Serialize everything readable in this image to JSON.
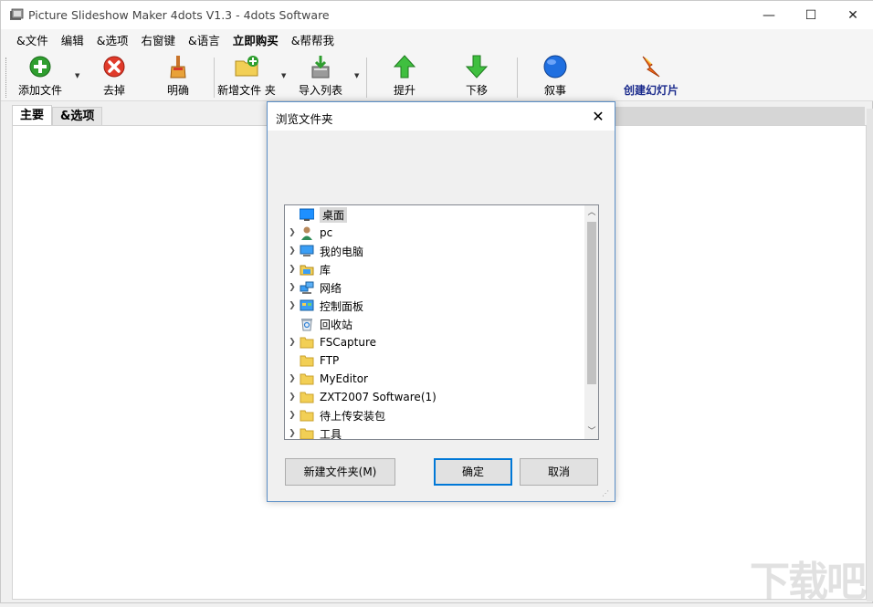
{
  "window": {
    "title": "Picture Slideshow Maker 4dots V1.3 - 4dots Software",
    "min_glyph": "—",
    "max_glyph": "☐",
    "close_glyph": "✕"
  },
  "menu": {
    "items": [
      {
        "label": "&文件"
      },
      {
        "label": "编辑"
      },
      {
        "label": "&选项"
      },
      {
        "label": "右窗键"
      },
      {
        "label": "&语言"
      },
      {
        "label": "立即购买"
      },
      {
        "label": "&帮帮我"
      }
    ]
  },
  "toolbar": {
    "add_files": "添加文件",
    "remove": "去掉",
    "clear": "明确",
    "add_folder": "新增文件 夹",
    "import_list": "导入列表",
    "move_up": "提升",
    "move_down": "下移",
    "narrate": "叙事",
    "create_slideshow": "创建幻灯片"
  },
  "tabs": [
    {
      "label": "主要"
    },
    {
      "label": "&选项"
    }
  ],
  "dialog": {
    "title": "浏览文件夹",
    "close_glyph": "✕",
    "tree": [
      {
        "label": "桌面",
        "icon": "desktop-icon",
        "expandable": false,
        "selected": true
      },
      {
        "label": "pc",
        "icon": "user-icon",
        "expandable": true
      },
      {
        "label": "我的电脑",
        "icon": "computer-icon",
        "expandable": true
      },
      {
        "label": "库",
        "icon": "library-icon",
        "expandable": true
      },
      {
        "label": "网络",
        "icon": "network-icon",
        "expandable": true
      },
      {
        "label": "控制面板",
        "icon": "control-panel-icon",
        "expandable": true
      },
      {
        "label": "回收站",
        "icon": "recycle-bin-icon",
        "expandable": false
      },
      {
        "label": "FSCapture",
        "icon": "folder-icon",
        "expandable": true
      },
      {
        "label": "FTP",
        "icon": "folder-icon",
        "expandable": false
      },
      {
        "label": "MyEditor",
        "icon": "folder-icon",
        "expandable": true
      },
      {
        "label": "ZXT2007 Software(1)",
        "icon": "folder-icon",
        "expandable": true
      },
      {
        "label": "待上传安装包",
        "icon": "folder-icon",
        "expandable": true
      },
      {
        "label": "工具",
        "icon": "folder-icon",
        "expandable": true
      }
    ],
    "new_folder_button": "新建文件夹(M)",
    "ok_button": "确定",
    "cancel_button": "取消"
  },
  "watermark": {
    "text": "下载吧"
  },
  "colors": {
    "accent": "#0078d7",
    "create_label": "#1a2a8c"
  }
}
